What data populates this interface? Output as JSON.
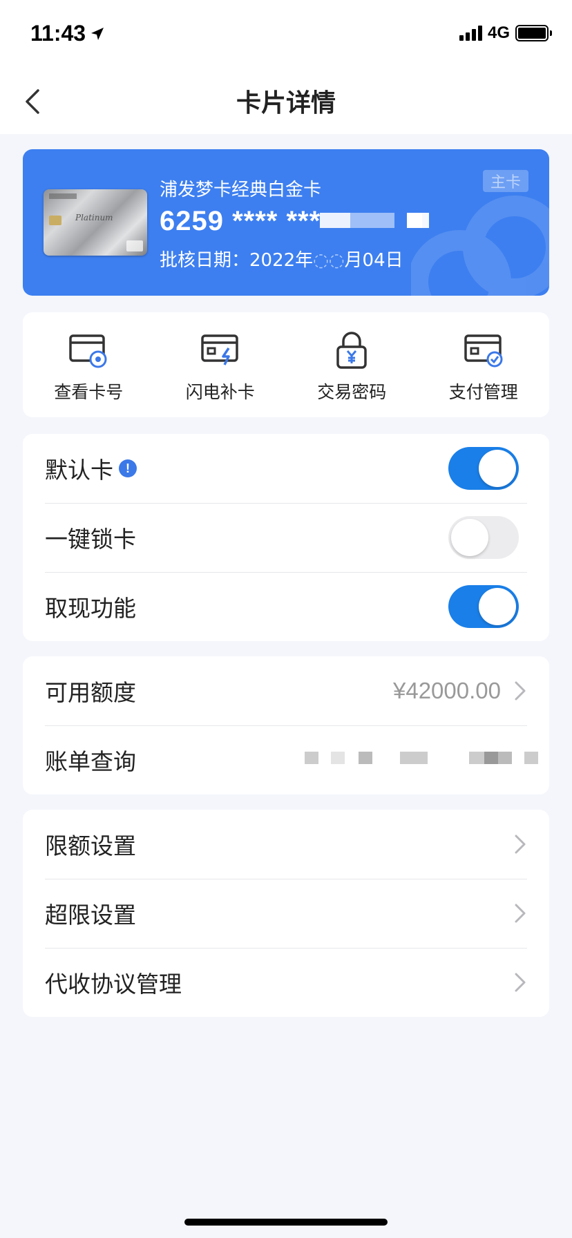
{
  "status_bar": {
    "time": "11:43",
    "network": "4G"
  },
  "nav": {
    "title": "卡片详情"
  },
  "card": {
    "name": "浦发梦卡经典白金卡",
    "number": "6259 **** ***",
    "approval_date": "批核日期：2022年",
    "approval_date_tail": "月04日",
    "badge": "主卡",
    "card_face_text": "Platinum"
  },
  "actions": [
    {
      "label": "查看卡号",
      "icon": "view-card-number-icon"
    },
    {
      "label": "闪电补卡",
      "icon": "flash-replace-card-icon"
    },
    {
      "label": "交易密码",
      "icon": "lock-yen-icon"
    },
    {
      "label": "支付管理",
      "icon": "payment-manage-icon"
    }
  ],
  "settings": {
    "default_card": {
      "label": "默认卡",
      "enabled": true
    },
    "lock_card": {
      "label": "一键锁卡",
      "enabled": false
    },
    "cash_withdraw": {
      "label": "取现功能",
      "enabled": true
    }
  },
  "account": {
    "available_limit_label": "可用额度",
    "available_limit_value": "¥42000.00",
    "bill_query_label": "账单查询"
  },
  "more": {
    "limit_settings": "限额设置",
    "over_limit_settings": "超限设置",
    "collection_agreement": "代收协议管理"
  },
  "colors": {
    "primary": "#3d7ff0",
    "toggle_on": "#1a7fe8",
    "background": "#f4f6fb"
  }
}
